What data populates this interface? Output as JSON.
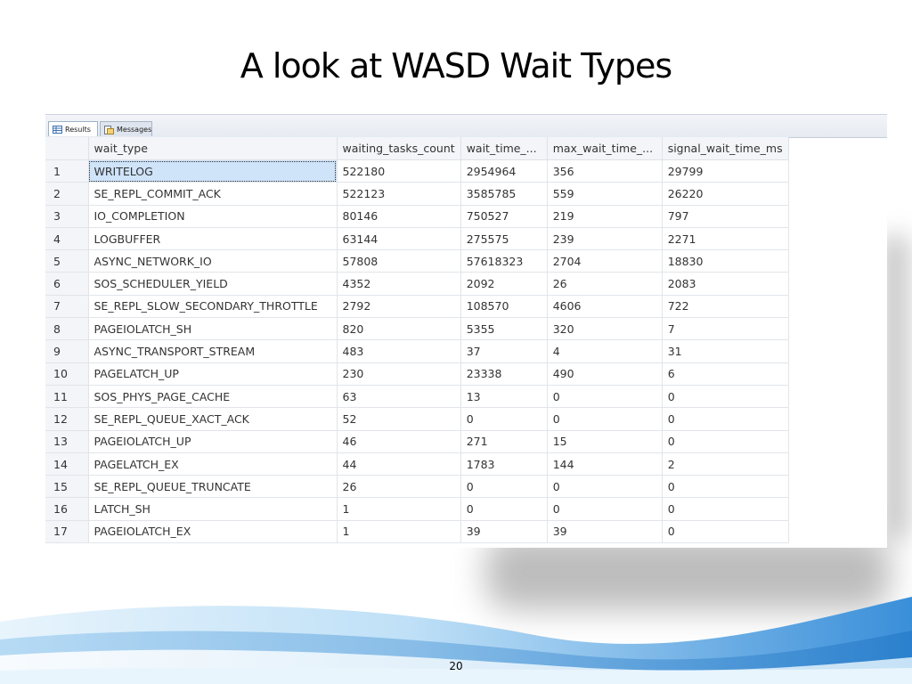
{
  "slide": {
    "title": "A look at WASD Wait Types",
    "page_number": "20"
  },
  "tabs": [
    {
      "label": "Results",
      "icon": "grid-icon"
    },
    {
      "label": "Messages",
      "icon": "messages-icon"
    }
  ],
  "grid": {
    "columns": [
      "wait_type",
      "waiting_tasks_count",
      "wait_time_...",
      "max_wait_time_...",
      "signal_wait_time_ms"
    ],
    "rows": [
      {
        "num": "1",
        "cells": [
          "WRITELOG",
          "522180",
          "2954964",
          "356",
          "29799"
        ]
      },
      {
        "num": "2",
        "cells": [
          "SE_REPL_COMMIT_ACK",
          "522123",
          "3585785",
          "559",
          "26220"
        ]
      },
      {
        "num": "3",
        "cells": [
          "IO_COMPLETION",
          "80146",
          "750527",
          "219",
          "797"
        ]
      },
      {
        "num": "4",
        "cells": [
          "LOGBUFFER",
          "63144",
          "275575",
          "239",
          "2271"
        ]
      },
      {
        "num": "5",
        "cells": [
          "ASYNC_NETWORK_IO",
          "57808",
          "57618323",
          "2704",
          "18830"
        ]
      },
      {
        "num": "6",
        "cells": [
          "SOS_SCHEDULER_YIELD",
          "4352",
          "2092",
          "26",
          "2083"
        ]
      },
      {
        "num": "7",
        "cells": [
          "SE_REPL_SLOW_SECONDARY_THROTTLE",
          "2792",
          "108570",
          "4606",
          "722"
        ]
      },
      {
        "num": "8",
        "cells": [
          "PAGEIOLATCH_SH",
          "820",
          "5355",
          "320",
          "7"
        ]
      },
      {
        "num": "9",
        "cells": [
          "ASYNC_TRANSPORT_STREAM",
          "483",
          "37",
          "4",
          "31"
        ]
      },
      {
        "num": "10",
        "cells": [
          "PAGELATCH_UP",
          "230",
          "23338",
          "490",
          "6"
        ]
      },
      {
        "num": "11",
        "cells": [
          "SOS_PHYS_PAGE_CACHE",
          "63",
          "13",
          "0",
          "0"
        ]
      },
      {
        "num": "12",
        "cells": [
          "SE_REPL_QUEUE_XACT_ACK",
          "52",
          "0",
          "0",
          "0"
        ]
      },
      {
        "num": "13",
        "cells": [
          "PAGEIOLATCH_UP",
          "46",
          "271",
          "15",
          "0"
        ]
      },
      {
        "num": "14",
        "cells": [
          "PAGELATCH_EX",
          "44",
          "1783",
          "144",
          "2"
        ]
      },
      {
        "num": "15",
        "cells": [
          "SE_REPL_QUEUE_TRUNCATE",
          "26",
          "0",
          "0",
          "0"
        ]
      },
      {
        "num": "16",
        "cells": [
          "LATCH_SH",
          "1",
          "0",
          "0",
          "0"
        ]
      },
      {
        "num": "17",
        "cells": [
          "PAGEIOLATCH_EX",
          "1",
          "39",
          "39",
          "0"
        ]
      }
    ]
  },
  "colors": {
    "selected_cell": "#cfe3f9",
    "wave_primary": "#3a8fd9",
    "wave_light": "#bfe0f7"
  }
}
